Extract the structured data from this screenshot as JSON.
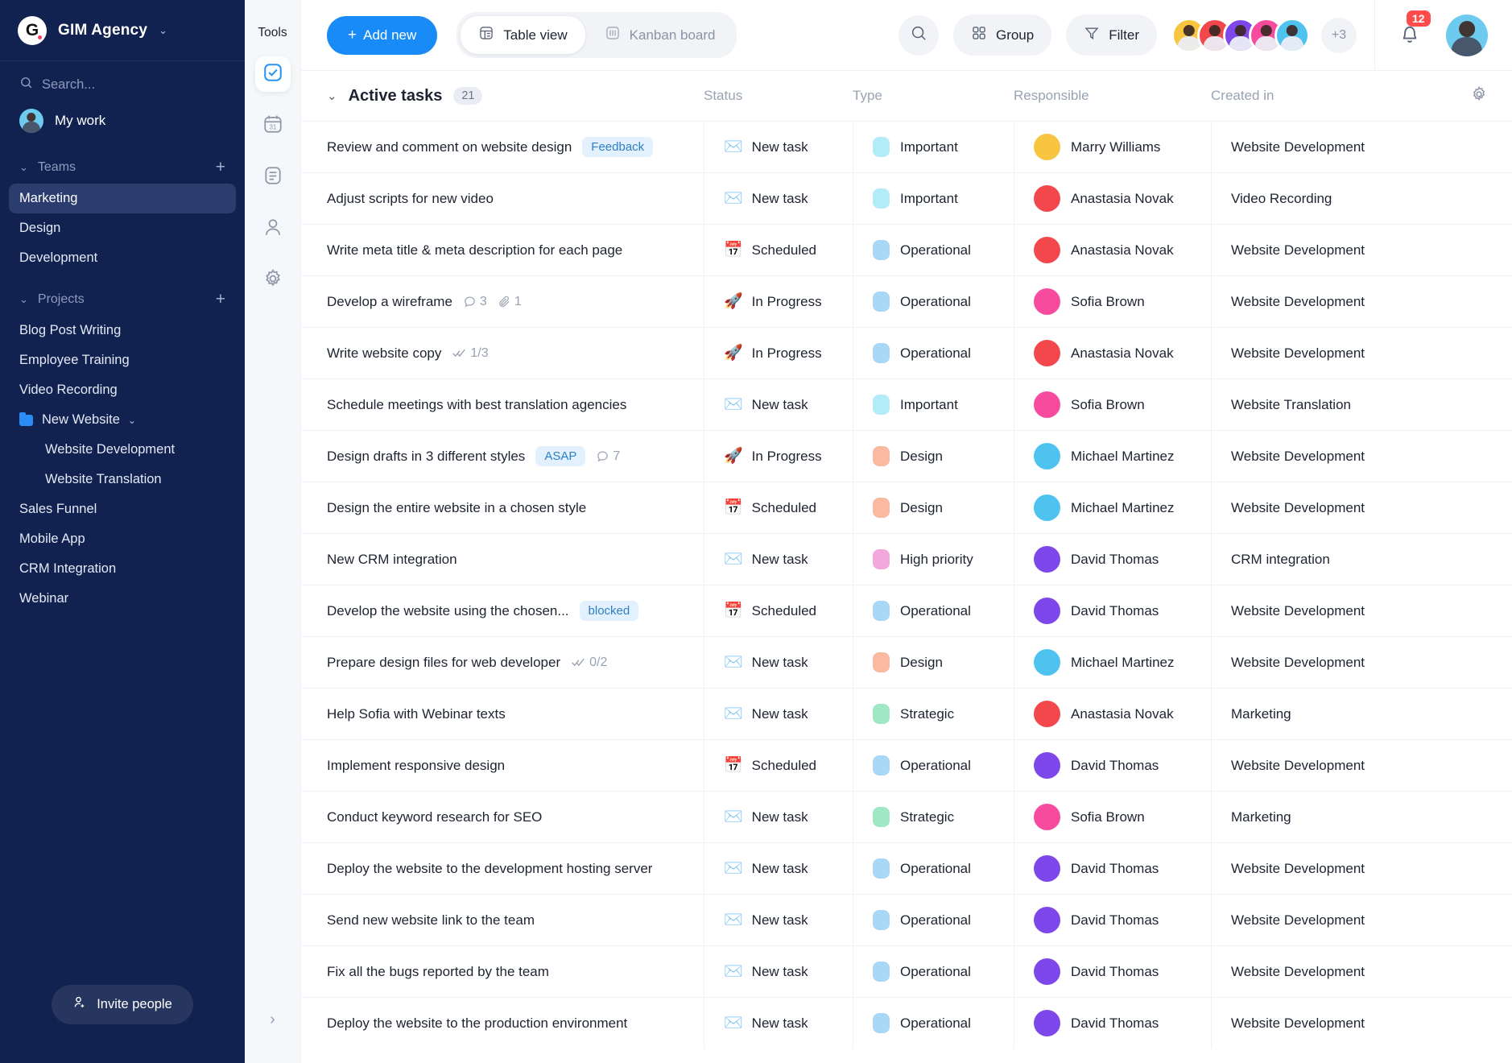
{
  "sidebar": {
    "brand": {
      "logo_letter": "G",
      "name": "GIM Agency",
      "chevron": "⌄"
    },
    "search": {
      "placeholder": "Search...",
      "icon": "search-icon"
    },
    "my_work": "My work",
    "teams": {
      "label": "Teams",
      "add": "+",
      "items": [
        "Marketing",
        "Design",
        "Development"
      ],
      "active": "Marketing"
    },
    "projects": {
      "label": "Projects",
      "add": "+",
      "items": [
        {
          "label": "Blog Post Writing",
          "type": "item"
        },
        {
          "label": "Employee Training",
          "type": "item"
        },
        {
          "label": "Video Recording",
          "type": "item"
        },
        {
          "label": "New Website",
          "type": "folder"
        },
        {
          "label": "Website Development",
          "type": "sub"
        },
        {
          "label": "Website Translation",
          "type": "sub"
        },
        {
          "label": "Sales Funnel",
          "type": "item"
        },
        {
          "label": "Mobile App",
          "type": "item"
        },
        {
          "label": "CRM Integration",
          "type": "item"
        },
        {
          "label": "Webinar",
          "type": "item"
        }
      ]
    },
    "invite_button": "Invite people"
  },
  "tools": {
    "title": "Tools",
    "items": [
      "tasks-check-icon",
      "calendar-icon",
      "document-icon",
      "contact-icon",
      "settings-gear-icon"
    ],
    "selected_index": 0,
    "expand": "›"
  },
  "topbar": {
    "add_new": "Add new",
    "views": [
      {
        "label": "Table view",
        "icon": "table-icon",
        "active": true
      },
      {
        "label": "Kanban board",
        "icon": "kanban-icon",
        "active": false
      }
    ],
    "search_icon": "search-icon",
    "group_label": "Group",
    "filter_label": "Filter",
    "avatars_overflow": "+3",
    "notifications_count": "12"
  },
  "table": {
    "group_title": "Active tasks",
    "group_count": "21",
    "columns": [
      "Status",
      "Type",
      "Responsible",
      "Created in"
    ],
    "settings_icon": "gear-icon",
    "rows": [
      {
        "task": "Review and comment on website design",
        "tag": "Feedback",
        "status": "New task",
        "status_icon": "✉️",
        "type": "Important",
        "type_color": "#b3ecf7",
        "responsible": "Marry Williams",
        "avatar_color": "#f7c53f",
        "created": "Website Development"
      },
      {
        "task": "Adjust scripts for new video",
        "tag": "",
        "status": "New task",
        "status_icon": "✉️",
        "type": "Important",
        "type_color": "#b3ecf7",
        "responsible": "Anastasia Novak",
        "avatar_color": "#f2484b",
        "created": "Video Recording"
      },
      {
        "task": "Write meta title & meta description for each page",
        "tag": "",
        "status": "Scheduled",
        "status_icon": "📅",
        "type": "Operational",
        "type_color": "#a9d8f7",
        "responsible": "Anastasia Novak",
        "avatar_color": "#f2484b",
        "created": "Website Development"
      },
      {
        "task": "Develop a wireframe",
        "tag": "",
        "comments": "3",
        "attachments": "1",
        "status": "In Progress",
        "status_icon": "🚀",
        "type": "Operational",
        "type_color": "#a9d8f7",
        "responsible": "Sofia Brown",
        "avatar_color": "#f74ba0",
        "created": "Website Development"
      },
      {
        "task": "Write website copy",
        "tag": "",
        "subtasks": "1/3",
        "status": "In Progress",
        "status_icon": "🚀",
        "type": "Operational",
        "type_color": "#a9d8f7",
        "responsible": "Anastasia Novak",
        "avatar_color": "#f2484b",
        "created": "Website Development"
      },
      {
        "task": "Schedule meetings with best translation agencies",
        "tag": "",
        "status": "New task",
        "status_icon": "✉️",
        "type": "Important",
        "type_color": "#b3ecf7",
        "responsible": "Sofia Brown",
        "avatar_color": "#f74ba0",
        "created": "Website Translation"
      },
      {
        "task": "Design drafts in 3 different styles",
        "tag": "ASAP",
        "comments": "7",
        "status": "In Progress",
        "status_icon": "🚀",
        "type": "Design",
        "type_color": "#fcb9a2",
        "responsible": "Michael Martinez",
        "avatar_color": "#4ec3f0",
        "created": "Website Development"
      },
      {
        "task": "Design the entire website in a chosen style",
        "tag": "",
        "status": "Scheduled",
        "status_icon": "📅",
        "type": "Design",
        "type_color": "#fcb9a2",
        "responsible": "Michael Martinez",
        "avatar_color": "#4ec3f0",
        "created": "Website Development"
      },
      {
        "task": "New CRM integration",
        "tag": "",
        "status": "New task",
        "status_icon": "✉️",
        "type": "High priority",
        "type_color": "#f2a8dd",
        "responsible": "David Thomas",
        "avatar_color": "#7d47ec",
        "created": "CRM integration"
      },
      {
        "task": "Develop the website using the chosen...",
        "tag": "blocked",
        "status": "Scheduled",
        "status_icon": "📅",
        "type": "Operational",
        "type_color": "#a9d8f7",
        "responsible": "David Thomas",
        "avatar_color": "#7d47ec",
        "created": "Website Development"
      },
      {
        "task": "Prepare design files for web developer",
        "tag": "",
        "subtasks": "0/2",
        "status": "New task",
        "status_icon": "✉️",
        "type": "Design",
        "type_color": "#fcb9a2",
        "responsible": "Michael Martinez",
        "avatar_color": "#4ec3f0",
        "created": "Website Development"
      },
      {
        "task": "Help Sofia with Webinar texts",
        "tag": "",
        "status": "New task",
        "status_icon": "✉️",
        "type": "Strategic",
        "type_color": "#9fe8c4",
        "responsible": "Anastasia Novak",
        "avatar_color": "#f2484b",
        "created": "Marketing"
      },
      {
        "task": "Implement responsive design",
        "tag": "",
        "status": "Scheduled",
        "status_icon": "📅",
        "type": "Operational",
        "type_color": "#a9d8f7",
        "responsible": "David Thomas",
        "avatar_color": "#7d47ec",
        "created": "Website Development"
      },
      {
        "task": "Conduct keyword research for SEO",
        "tag": "",
        "status": "New task",
        "status_icon": "✉️",
        "type": "Strategic",
        "type_color": "#9fe8c4",
        "responsible": "Sofia Brown",
        "avatar_color": "#f74ba0",
        "created": "Marketing"
      },
      {
        "task": "Deploy the website to the development hosting server",
        "tag": "",
        "status": "New task",
        "status_icon": "✉️",
        "type": "Operational",
        "type_color": "#a9d8f7",
        "responsible": "David Thomas",
        "avatar_color": "#7d47ec",
        "created": "Website Development"
      },
      {
        "task": "Send new website link to the team",
        "tag": "",
        "status": "New task",
        "status_icon": "✉️",
        "type": "Operational",
        "type_color": "#a9d8f7",
        "responsible": "David Thomas",
        "avatar_color": "#7d47ec",
        "created": "Website Development"
      },
      {
        "task": "Fix all the bugs reported by the team",
        "tag": "",
        "status": "New task",
        "status_icon": "✉️",
        "type": "Operational",
        "type_color": "#a9d8f7",
        "responsible": "David Thomas",
        "avatar_color": "#7d47ec",
        "created": "Website Development"
      },
      {
        "task": "Deploy the website to the production environment",
        "tag": "",
        "status": "New task",
        "status_icon": "✉️",
        "type": "Operational",
        "type_color": "#a9d8f7",
        "responsible": "David Thomas",
        "avatar_color": "#7d47ec",
        "created": "Website Development"
      }
    ]
  },
  "colors": {
    "sidebar_bg": "#122250",
    "accent": "#188bf6",
    "badge_red": "#ff4b4b",
    "tag_bg": "#e2f1fd",
    "tag_text": "#2e7fc4"
  },
  "topbar_avatar_colors": [
    "#f7c53f",
    "#f2484b",
    "#7d47ec",
    "#f74ba0",
    "#4ec3f0"
  ]
}
